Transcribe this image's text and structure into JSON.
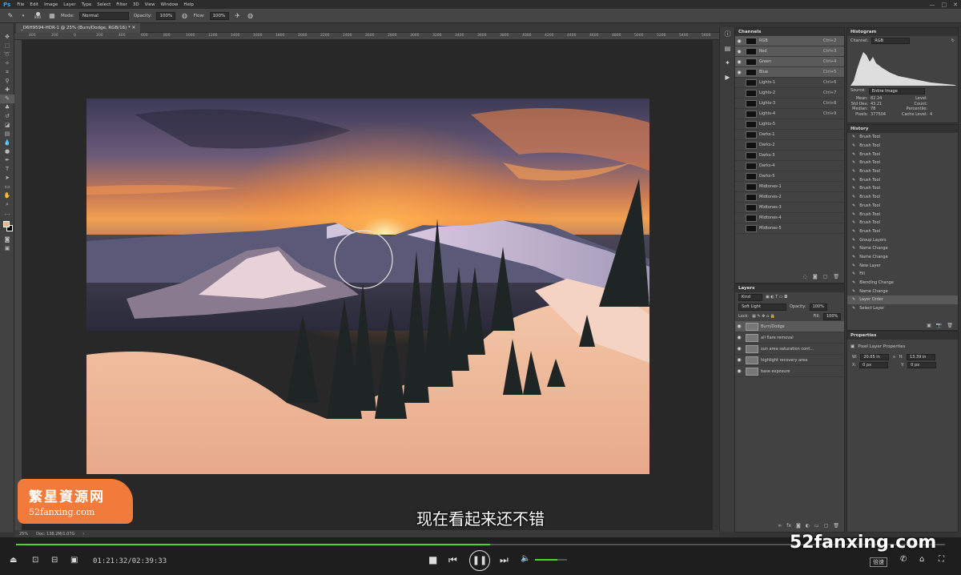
{
  "app": {
    "logo": "Ps",
    "menu": [
      "File",
      "Edit",
      "Image",
      "Layer",
      "Type",
      "Select",
      "Filter",
      "3D",
      "View",
      "Window",
      "Help"
    ]
  },
  "options": {
    "size": "800",
    "mode_label": "Mode:",
    "mode_value": "Normal",
    "opacity_label": "Opacity:",
    "opacity_value": "100%",
    "flow_label": "Flow:",
    "flow_value": "100%"
  },
  "document": {
    "tab_title": "_D6H9594-HDR-1 @ 25% (Burn/Dodge, RGB/16) *",
    "zoom": "25%",
    "doc_info": "Doc: 138.2M/1.07G"
  },
  "ruler_ticks": [
    "400",
    "200",
    "0",
    "200",
    "400",
    "600",
    "800",
    "1000",
    "1200",
    "1400",
    "1600",
    "1800",
    "2000",
    "2200",
    "2400",
    "2600",
    "2800",
    "3000",
    "3200",
    "3400",
    "3600",
    "3800",
    "4000",
    "4200",
    "4400",
    "4600",
    "4800",
    "5000",
    "5200",
    "5400",
    "5600",
    "5800"
  ],
  "channels": {
    "title": "Channels",
    "items": [
      {
        "name": "RGB",
        "key": "Ctrl+2",
        "sel": true
      },
      {
        "name": "Red",
        "key": "Ctrl+3",
        "sel": true
      },
      {
        "name": "Green",
        "key": "Ctrl+4",
        "sel": true
      },
      {
        "name": "Blue",
        "key": "Ctrl+5",
        "sel": true
      },
      {
        "name": "Lights-1",
        "key": "Ctrl+6"
      },
      {
        "name": "Lights-2",
        "key": "Ctrl+7"
      },
      {
        "name": "Lights-3",
        "key": "Ctrl+8"
      },
      {
        "name": "Lights-4",
        "key": "Ctrl+9"
      },
      {
        "name": "Lights-5",
        "key": ""
      },
      {
        "name": "Darks-1",
        "key": ""
      },
      {
        "name": "Darks-2",
        "key": ""
      },
      {
        "name": "Darks-3",
        "key": ""
      },
      {
        "name": "Darks-4",
        "key": ""
      },
      {
        "name": "Darks-5",
        "key": ""
      },
      {
        "name": "Midtones-1",
        "key": ""
      },
      {
        "name": "Midtones-2",
        "key": ""
      },
      {
        "name": "Midtones-3",
        "key": ""
      },
      {
        "name": "Midtones-4",
        "key": ""
      },
      {
        "name": "Midtones-5",
        "key": ""
      }
    ]
  },
  "layers": {
    "title": "Layers",
    "kind": "Kind",
    "blend": "Soft Light",
    "opacity_label": "Opacity:",
    "opacity": "100%",
    "lock_label": "Lock:",
    "fill_label": "Fill:",
    "fill": "100%",
    "items": [
      {
        "name": "Burn/Dodge",
        "sel": true
      },
      {
        "name": "all flare removal"
      },
      {
        "name": "sun area saturation cont..."
      },
      {
        "name": "highlight recovery area"
      },
      {
        "name": "base exposure"
      }
    ]
  },
  "histogram": {
    "title": "Histogram",
    "channel_label": "Channel:",
    "channel": "RGB",
    "source_label": "Source:",
    "source": "Entire Image",
    "stats": [
      {
        "k": "Mean:",
        "v": "82.24",
        "k2": "Level:",
        "v2": ""
      },
      {
        "k": "Std Dev:",
        "v": "43.21",
        "k2": "Count:",
        "v2": ""
      },
      {
        "k": "Median:",
        "v": "78",
        "k2": "Percentile:",
        "v2": ""
      },
      {
        "k": "Pixels:",
        "v": "377504",
        "k2": "Cache Level:",
        "v2": "4"
      }
    ]
  },
  "history": {
    "title": "History",
    "items": [
      {
        "name": "Brush Tool"
      },
      {
        "name": "Brush Tool"
      },
      {
        "name": "Brush Tool"
      },
      {
        "name": "Brush Tool"
      },
      {
        "name": "Brush Tool"
      },
      {
        "name": "Brush Tool"
      },
      {
        "name": "Brush Tool"
      },
      {
        "name": "Brush Tool"
      },
      {
        "name": "Brush Tool"
      },
      {
        "name": "Brush Tool"
      },
      {
        "name": "Brush Tool"
      },
      {
        "name": "Brush Tool"
      },
      {
        "name": "Group Layers"
      },
      {
        "name": "Name Change"
      },
      {
        "name": "Name Change"
      },
      {
        "name": "New Layer"
      },
      {
        "name": "Fill"
      },
      {
        "name": "Blending Change"
      },
      {
        "name": "Name Change"
      },
      {
        "name": "Layer Order",
        "sel": true
      },
      {
        "name": "Select Layer"
      }
    ]
  },
  "properties": {
    "title": "Properties",
    "subtitle": "Pixel Layer Properties",
    "w_label": "W:",
    "w": "20.05 in",
    "h_label": "H:",
    "h": "13.39 in",
    "x_label": "X:",
    "x": "0 px",
    "y_label": "Y:",
    "y": "0 px"
  },
  "player": {
    "time": "01:21:32/02:39:33",
    "speed": "倍速",
    "progress": 0.51,
    "volume": 0.7
  },
  "overlay": {
    "subtitle": "现在看起来还不错",
    "watermark": "52fanxing.com",
    "badge_title": "繁星資源网",
    "badge_url": "52fanxing.com"
  }
}
